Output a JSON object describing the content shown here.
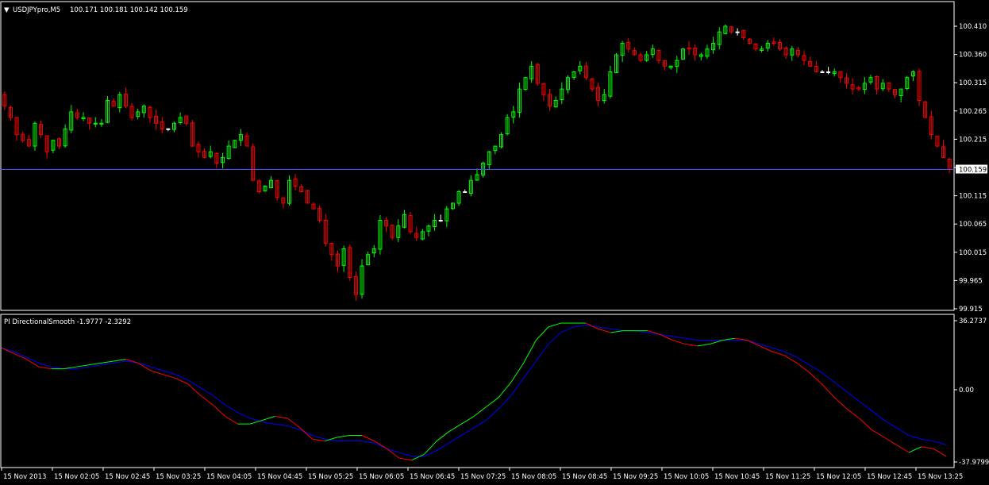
{
  "main_panel": {
    "header": {
      "symbol": "USDJPYpro,M5",
      "ohlc": "100.171 100.181 100.142 100.159"
    },
    "current_price_label": "100.159"
  },
  "indicator_panel": {
    "header": "PI DirectionalSmooth -1.9777 -2.3292"
  },
  "colors": {
    "background": "#000000",
    "frame": "#ffffff",
    "bull": "#00ff00",
    "bear": "#ff0000",
    "doji": "#ffffff",
    "price_line": "#4a4aff",
    "fast_line_up": "#00ff00",
    "fast_line_down": "#ff0000",
    "slow_line": "#0000ff"
  },
  "chart_data": [
    {
      "type": "candlestick",
      "title": "USDJPYpro,M5",
      "ylim": [
        99.915,
        100.41
      ],
      "y_ticks": [
        "100.410",
        "100.360",
        "100.315",
        "100.265",
        "100.215",
        "100.165",
        "100.115",
        "100.065",
        "100.015",
        "99.965",
        "99.915"
      ],
      "current_price": 100.159,
      "x_ticks": [
        "15 Nov 2013",
        "15 Nov 02:05",
        "15 Nov 02:45",
        "15 Nov 03:25",
        "15 Nov 04:05",
        "15 Nov 04:45",
        "15 Nov 05:25",
        "15 Nov 06:05",
        "15 Nov 06:45",
        "15 Nov 07:25",
        "15 Nov 08:05",
        "15 Nov 08:45",
        "15 Nov 09:25",
        "15 Nov 10:05",
        "15 Nov 10:45",
        "15 Nov 11:25",
        "15 Nov 12:05",
        "15 Nov 12:45",
        "15 Nov 13:25"
      ],
      "closes": [
        100.27,
        100.25,
        100.22,
        100.21,
        100.2,
        100.24,
        100.22,
        100.19,
        100.21,
        100.2,
        100.23,
        100.26,
        100.25,
        100.25,
        100.24,
        100.24,
        100.24,
        100.28,
        100.27,
        100.29,
        100.27,
        100.25,
        100.26,
        100.27,
        100.25,
        100.24,
        100.23,
        100.23,
        100.24,
        100.25,
        100.24,
        100.2,
        100.19,
        100.18,
        100.19,
        100.17,
        100.18,
        100.2,
        100.21,
        100.22,
        100.2,
        100.14,
        100.12,
        100.13,
        100.14,
        100.11,
        100.1,
        100.14,
        100.13,
        100.12,
        100.1,
        100.09,
        100.07,
        100.03,
        100.01,
        99.99,
        100.02,
        99.97,
        99.94,
        99.99,
        100.01,
        100.02,
        100.07,
        100.06,
        100.04,
        100.06,
        100.08,
        100.05,
        100.04,
        100.05,
        100.06,
        100.07,
        100.07,
        100.09,
        100.1,
        100.12,
        100.12,
        100.14,
        100.15,
        100.17,
        100.19,
        100.2,
        100.22,
        100.25,
        100.26,
        100.3,
        100.32,
        100.34,
        100.31,
        100.29,
        100.27,
        100.28,
        100.3,
        100.32,
        100.33,
        100.34,
        100.32,
        100.3,
        100.28,
        100.29,
        100.33,
        100.36,
        100.38,
        100.37,
        100.36,
        100.35,
        100.36,
        100.37,
        100.35,
        100.34,
        100.34,
        100.35,
        100.37,
        100.37,
        100.36,
        100.36,
        100.37,
        100.38,
        100.4,
        100.41,
        100.4,
        100.4,
        100.39,
        100.38,
        100.37,
        100.37,
        100.38,
        100.38,
        100.37,
        100.36,
        100.37,
        100.36,
        100.35,
        100.34,
        100.33,
        100.33,
        100.33,
        100.33,
        100.32,
        100.31,
        100.3,
        100.3,
        100.31,
        100.32,
        100.3,
        100.31,
        100.3,
        100.29,
        100.3,
        100.32,
        100.33,
        100.28,
        100.25,
        100.22,
        100.2,
        100.18,
        100.159
      ]
    },
    {
      "type": "line",
      "title": "PI DirectionalSmooth",
      "ylim": [
        -37.9799,
        36.2737
      ],
      "y_ticks": [
        "36.2737",
        "0.00",
        "-37.9799"
      ],
      "current_values": [
        -1.9777,
        -2.3292
      ],
      "x_ticks": [
        "15 Nov 2013",
        "15 Nov 02:05",
        "15 Nov 02:45",
        "15 Nov 03:25",
        "15 Nov 04:05",
        "15 Nov 04:45",
        "15 Nov 05:25",
        "15 Nov 06:05",
        "15 Nov 06:45",
        "15 Nov 07:25",
        "15 Nov 08:05",
        "15 Nov 08:45",
        "15 Nov 09:25",
        "15 Nov 10:05",
        "15 Nov 10:45",
        "15 Nov 11:25",
        "15 Nov 12:05",
        "15 Nov 12:45",
        "15 Nov 13:25"
      ],
      "series": [
        {
          "values": [
            22,
            19,
            16,
            12,
            11,
            11,
            12,
            13,
            14,
            15,
            16,
            14,
            10,
            8,
            6,
            3,
            -3,
            -8,
            -14,
            -18,
            -18,
            -16,
            -14,
            -15,
            -20,
            -26,
            -27,
            -25,
            -24,
            -24,
            -27,
            -31,
            -36,
            -37,
            -34,
            -27,
            -22,
            -18,
            -14,
            -9,
            -4,
            4,
            14,
            26,
            33,
            35,
            35,
            35,
            32,
            30,
            31,
            31,
            31,
            29,
            26,
            24,
            23,
            24,
            26,
            27,
            26,
            23,
            20,
            18,
            14,
            9,
            3,
            -4,
            -10,
            -15,
            -21,
            -25,
            -29,
            -33,
            -30,
            -31,
            -35
          ]
        },
        {
          "values": [
            22,
            20,
            17,
            14,
            12,
            11,
            11,
            12,
            13,
            14,
            15,
            14,
            12,
            10,
            8,
            5,
            1,
            -3,
            -8,
            -12,
            -15,
            -17,
            -18,
            -19,
            -21,
            -24,
            -26,
            -27,
            -27,
            -27,
            -28,
            -31,
            -33,
            -35,
            -35,
            -32,
            -28,
            -24,
            -20,
            -16,
            -10,
            -3,
            6,
            15,
            24,
            30,
            33,
            34,
            33,
            32,
            31,
            31,
            30,
            29,
            28,
            27,
            26,
            26,
            26,
            26,
            26,
            24,
            22,
            20,
            17,
            13,
            9,
            4,
            -1,
            -6,
            -11,
            -16,
            -20,
            -24,
            -26,
            -27,
            -29
          ]
        }
      ]
    }
  ]
}
